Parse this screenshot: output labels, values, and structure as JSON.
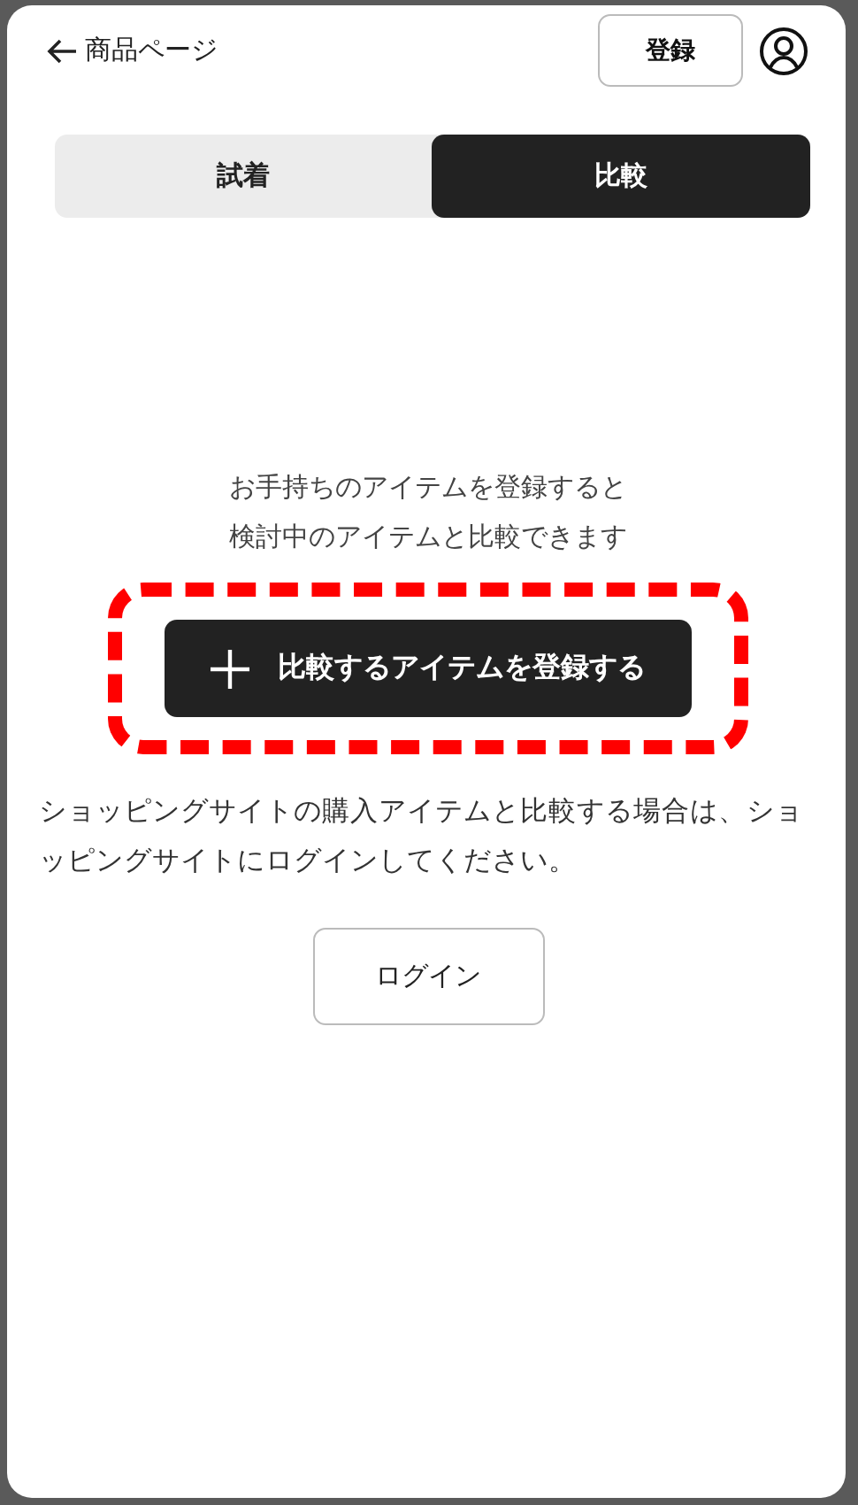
{
  "header": {
    "back_link": "商品ページ",
    "register_button": "登録"
  },
  "tabs": [
    {
      "label": "試着",
      "selected": false
    },
    {
      "label": "比較",
      "selected": true
    }
  ],
  "message_lines": [
    "お手持ちのアイテムを登録すると",
    "検討中のアイテムと比較できます"
  ],
  "add_button": {
    "label": "比較するアイテムを登録する",
    "highlighted": true
  },
  "note": "ショッピングサイトの購入アイテムと比較する場合は、ショッピングサイトにログインしてください。",
  "login_button": "ログイン"
}
